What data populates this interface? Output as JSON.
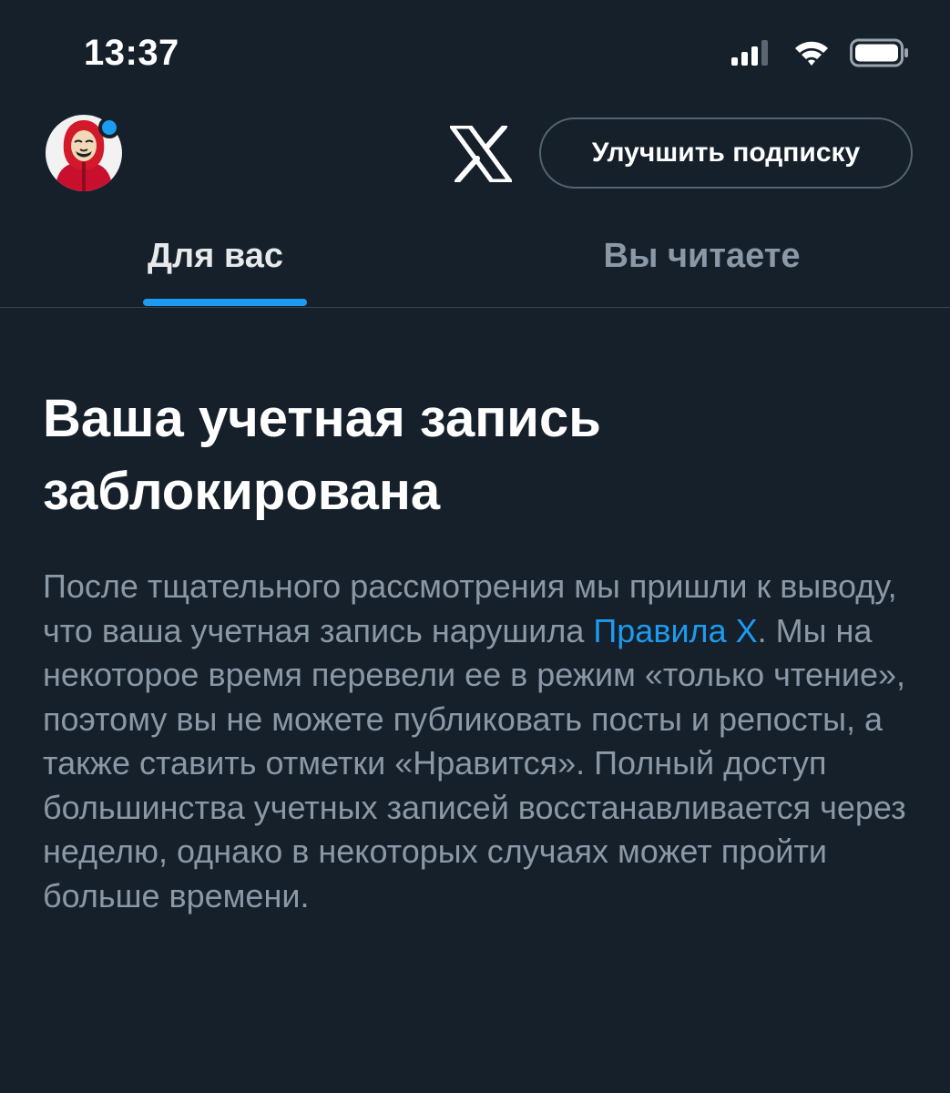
{
  "status_bar": {
    "time": "13:37",
    "icons": [
      "cellular-signal-icon",
      "wifi-icon",
      "battery-icon"
    ]
  },
  "header": {
    "avatar": "profile-avatar",
    "logo": "x-logo-icon",
    "upgrade_label": "Улучшить подписку"
  },
  "tabs": [
    {
      "label": "Для вас",
      "active": true
    },
    {
      "label": "Вы читаете",
      "active": false
    }
  ],
  "notice": {
    "title": "Ваша учетная запись заблокирована",
    "body_before": "После тщательного рассмотрения мы пришли к выводу, что ваша учетная запись нарушила ",
    "link_label": "Правила X",
    "body_after": ". Мы на некоторое время перевели ее в режим «только чтение», поэтому вы не можете публиковать посты и репосты, а также ставить отметки «Нравится». Полный доступ большинства учетных записей восстанавливается через неделю, однако в некоторых случаях может пройти больше времени."
  },
  "colors": {
    "background": "#15202b",
    "accent": "#1d9bf0",
    "primary_text": "#e7e9ea",
    "secondary_text": "#8b98a5",
    "divider": "#38444d"
  }
}
